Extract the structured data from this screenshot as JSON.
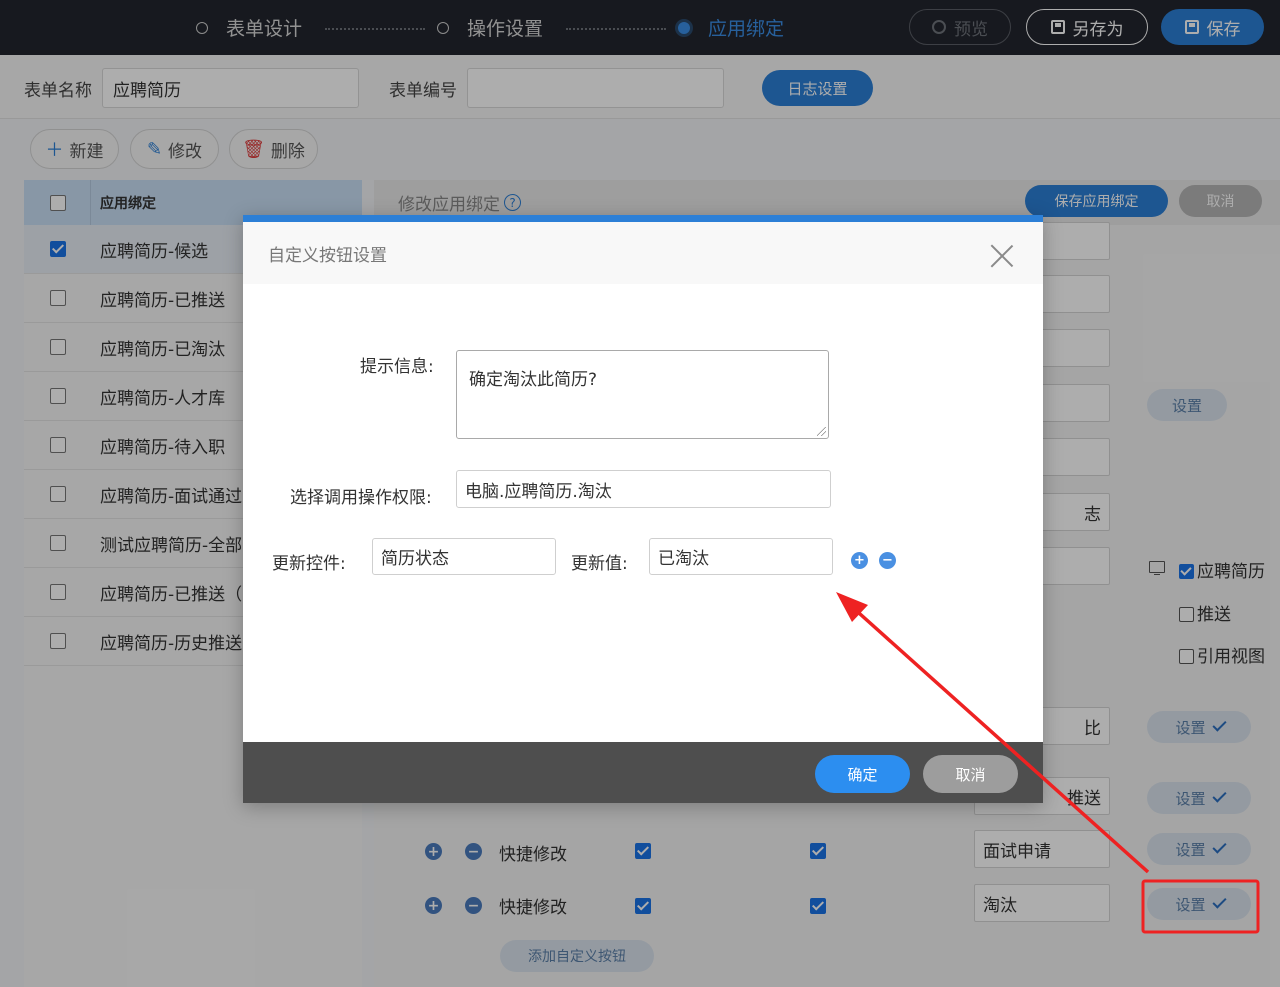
{
  "steps": [
    {
      "label": "表单设计",
      "active": false
    },
    {
      "label": "操作设置",
      "active": false
    },
    {
      "label": "应用绑定",
      "active": true
    }
  ],
  "topbar": {
    "preview_label": "预览",
    "save_as_label": "另存为",
    "save_label": "保存"
  },
  "form": {
    "name_label": "表单名称",
    "name_value": "应聘简历",
    "code_label": "表单编号",
    "code_value": "",
    "log_button": "日志设置"
  },
  "toolbar": {
    "new_label": "新建",
    "edit_label": "修改",
    "delete_label": "删除"
  },
  "list": {
    "header": "应用绑定",
    "rows": [
      {
        "label": "应聘简历-候选",
        "checked": true
      },
      {
        "label": "应聘简历-已推送",
        "checked": false
      },
      {
        "label": "应聘简历-已淘汰",
        "checked": false
      },
      {
        "label": "应聘简历-人才库",
        "checked": false
      },
      {
        "label": "应聘简历-待入职",
        "checked": false
      },
      {
        "label": "应聘简历-面试通过",
        "checked": false
      },
      {
        "label": "测试应聘简历-全部",
        "checked": false
      },
      {
        "label": "应聘简历-已推送（",
        "checked": false
      },
      {
        "label": "应聘简历-历史推送",
        "checked": false
      }
    ]
  },
  "right": {
    "title": "修改应用绑定",
    "save_binding": "保存应用绑定",
    "cancel": "取消",
    "set_label": "设置",
    "partial_1": "志",
    "partial_2": "比",
    "partial_3": "推送",
    "checkbox_app": "应聘简历",
    "checkbox_push": "推送",
    "checkbox_view": "引用视图",
    "rows": [
      {
        "action": "快捷修改",
        "value": "面试申请"
      },
      {
        "action": "快捷修改",
        "value": "淘汰"
      }
    ],
    "add_custom_button": "添加自定义按钮"
  },
  "modal": {
    "title": "自定义按钮设置",
    "prompt_label": "提示信息:",
    "prompt_value": "确定淘汰此简历?",
    "permission_label": "选择调用操作权限:",
    "permission_value": "电脑.应聘简历.淘汰",
    "update_control_label": "更新控件:",
    "update_control_value": "简历状态",
    "update_value_label": "更新值:",
    "update_value_value": "已淘汰",
    "ok": "确定",
    "cancel": "取消"
  },
  "colors": {
    "accent": "#2c7fd6",
    "annotation": "#ee2222"
  }
}
